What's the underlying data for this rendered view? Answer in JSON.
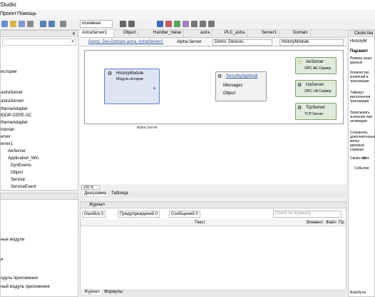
{
  "app": {
    "title": "Studio"
  },
  "menu": {
    "items": [
      "Проект",
      "Помощь"
    ]
  },
  "toolbar": {
    "combo1": "основная",
    "combo2": "100",
    "zoom": "100"
  },
  "tree": {
    "items": [
      "истории",
      "astraServer",
      "astraServer/",
      "therneAdapter",
      "ЮОР-СЕРЕ-SC",
      "therneAdapter",
      "istorian",
      "erver",
      "erver1",
      "AeServer",
      "Application_Win",
      "DynEvents",
      "Object",
      "Service",
      "ServiceEvent"
    ]
  },
  "left_bottom": {
    "items": [
      "ные модули",
      "и",
      "одуль приложения",
      "ный модуль приложения"
    ]
  },
  "tabs": [
    "AstraServer1",
    "Object",
    "Handler_Value",
    "astra",
    "PLC_astra",
    "Server1",
    "Domain"
  ],
  "address": {
    "path": "Demo. Dev.Domain.astra. AstraServer1",
    "user": "Alpha.Server",
    "domain": "Demo. Devices",
    "module": "HistoryModule"
  },
  "diagram": {
    "history": {
      "title": "HistoryModule",
      "subtitle": "Модуль истории"
    },
    "security": {
      "title": "SecurityApplicati",
      "items": [
        "Messages",
        "Object"
      ]
    },
    "ae": {
      "title": "AeServer",
      "subtitle": "OPC AE Сервер"
    },
    "ua": {
      "title": "UaServer",
      "subtitle": "OPC UA Сервер"
    },
    "tcp": {
      "title": "TcpServer",
      "subtitle": "TCP Server"
    },
    "footer_label": "Alpha Server"
  },
  "view_tabs": [
    "Диаграмма",
    "Таблица"
  ],
  "zoom_label": "100 %",
  "journal": {
    "title": "Журнал",
    "errors": "Ошибок 0",
    "warnings": "Предупреждений 0",
    "messages": "Сообщений 0",
    "search_placeholder": "Поиск по журналу",
    "columns": [
      "Текст",
      "Элемент",
      "Файл",
      "Пр"
    ]
  },
  "bottom_tabs": [
    "Журнал",
    "Формулы"
  ],
  "properties": {
    "title": "Свойства",
    "target": "HistoryM",
    "section": "Парамет",
    "rows": [
      "Размер кэша данных",
      "Количество значений в транзакции",
      "Таймаут выполнения транзакции",
      "Записывать значения при активации",
      "Сохранять дополнительно метку времени сервера"
    ],
    "tabs": [
      "Свойства",
      "Эле"
    ],
    "events": "События",
    "bottom_tab": "Атрибуты"
  },
  "colors": {
    "accent": "#2b579a",
    "panel_header": "#e8e8e8",
    "node_blue": "#5b7fc7",
    "node_green": "#9fbf8f"
  }
}
